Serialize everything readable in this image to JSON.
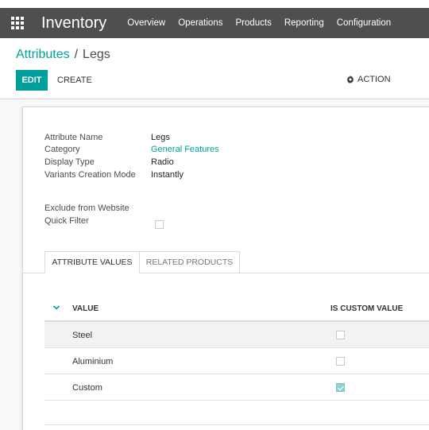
{
  "navbar": {
    "app_title": "Inventory",
    "menu": [
      "Overview",
      "Operations",
      "Products",
      "Reporting",
      "Configuration"
    ]
  },
  "breadcrumb": {
    "parent": "Attributes",
    "separator": "/",
    "current": "Legs"
  },
  "buttons": {
    "edit": "EDIT",
    "create": "CREATE",
    "action": "ACTION"
  },
  "form": {
    "fields": [
      {
        "label": "Attribute Name",
        "value": "Legs"
      },
      {
        "label": "Category",
        "value": "General Features"
      },
      {
        "label": "Display Type",
        "value": "Radio"
      },
      {
        "label": "Variants Creation Mode",
        "value": "Instantly"
      }
    ],
    "exclude_label_line1": "Exclude from Website",
    "exclude_label_line2": "Quick Filter",
    "exclude_checked": false
  },
  "tabs": {
    "active": "ATTRIBUTE VALUES",
    "inactive": "RELATED PRODUCTS"
  },
  "table": {
    "headers": {
      "value": "VALUE",
      "custom": "IS CUSTOM VALUE"
    },
    "rows": [
      {
        "value": "Steel",
        "is_custom": false
      },
      {
        "value": "Aluminium",
        "is_custom": false
      },
      {
        "value": "Custom",
        "is_custom": true
      }
    ]
  },
  "colors": {
    "navbar": "#4f4f4f",
    "accent": "#00a09d"
  },
  "icons": {
    "apps": "apps-grid-icon",
    "action": "gear-icon",
    "sort": "chevron-down-icon"
  }
}
